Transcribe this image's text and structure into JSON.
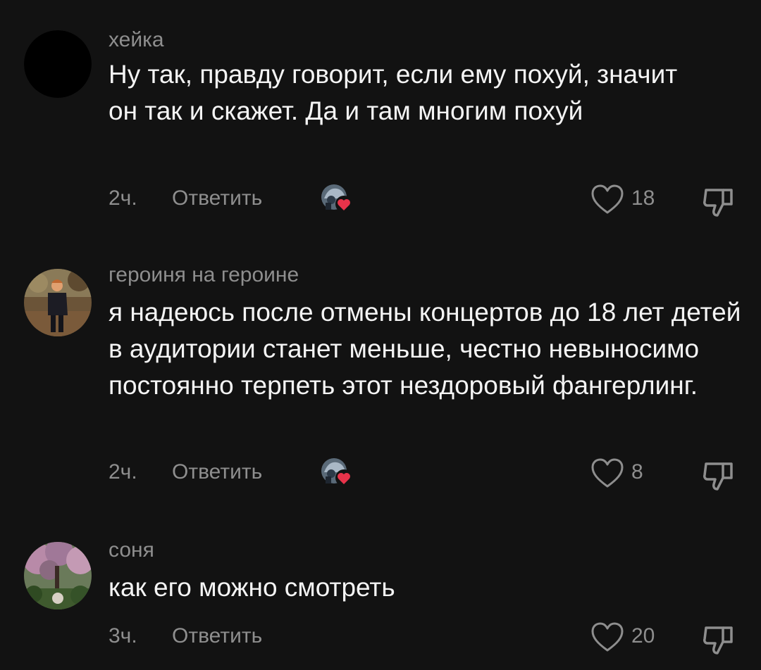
{
  "comments": [
    {
      "author": "хейка",
      "text": "Ну так, правду говорит, если ему похуй, значит он так и скажет. Да и там многим похуй",
      "time": "2ч.",
      "reply_label": "Ответить",
      "likes": "18",
      "avatar_icon": "black-circle-avatar",
      "creator_liked": true
    },
    {
      "author": "героиня на героине",
      "text": "я надеюсь после отмены концертов до 18 лет детей в аудитории станет меньше, честно невыносимо постоянно терпеть этот нездоровый фангерлинг.",
      "time": "2ч.",
      "reply_label": "Ответить",
      "likes": "8",
      "avatar_icon": "person-photo-avatar",
      "creator_liked": true
    },
    {
      "author": "соня",
      "text": "как его можно смотреть",
      "time": "3ч.",
      "reply_label": "Ответить",
      "likes": "20",
      "avatar_icon": "garden-photo-avatar",
      "creator_liked": false
    }
  ],
  "colors": {
    "background": "#121212",
    "text": "#f4f4f4",
    "muted": "#8e8e8e",
    "heart_badge": "#e8334a"
  }
}
